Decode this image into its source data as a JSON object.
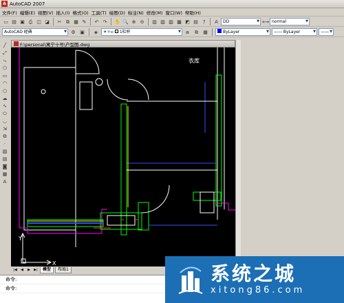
{
  "app": {
    "title": "AutoCAD 2007",
    "icon_name": "autocad-app-icon"
  },
  "menu": [
    "文件(F)",
    "编辑(E)",
    "视图(V)",
    "插入(I)",
    "格式(O)",
    "工具(T)",
    "绘图(D)",
    "标注(N)",
    "修改(M)",
    "窗口(W)",
    "帮助(H)"
  ],
  "toolbar": {
    "workspace": "AutoCAD 经典",
    "layer": "1栏杆",
    "textstyle": "DD",
    "dimstyle": "normal",
    "color": "ByLayer",
    "linetype": "ByLayer",
    "lineweight": "ByLayer"
  },
  "document": {
    "title": "F:\\personal\\寓宁十号\\户型图.dwg"
  },
  "drawing": {
    "room_label": "衣库"
  },
  "ucs": {
    "x": "X",
    "y": "Y"
  },
  "tabs": [
    "模型",
    "布局1"
  ],
  "command": {
    "line1": "命令:",
    "line2": "命令:"
  },
  "watermark": {
    "title": "系统之城",
    "url": "xitong86.com",
    "color": "#1c6fb5"
  },
  "colors": {
    "canvas": "#000000",
    "accent": "#c0281e"
  }
}
